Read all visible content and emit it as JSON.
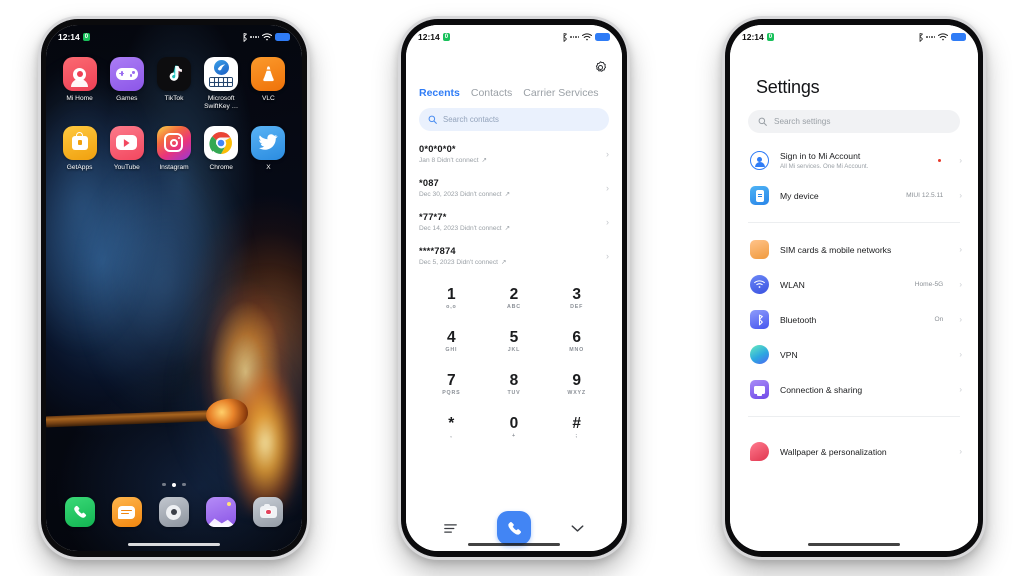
{
  "status_bar": {
    "time": "12:14",
    "battery_badge": "0",
    "icons": [
      "bluetooth-icon",
      "signal-dots-icon",
      "wifi-icon",
      "battery-icon"
    ],
    "battery_color": "#2f7cf6"
  },
  "home_screen": {
    "wallpaper_description": "burning matchstick",
    "apps": [
      {
        "label": "Mi Home",
        "icon": "mi-home-icon",
        "color": "#f2545c"
      },
      {
        "label": "Games",
        "icon": "games-icon",
        "color": "#9b6ef0"
      },
      {
        "label": "TikTok",
        "icon": "tiktok-icon",
        "color": "#0d0d0f"
      },
      {
        "label": "Microsoft SwiftKey …",
        "icon": "swiftkey-icon",
        "color": "#ffffff"
      },
      {
        "label": "VLC",
        "icon": "vlc-icon",
        "color": "#f08013"
      },
      {
        "label": "GetApps",
        "icon": "getapps-icon",
        "color": "#f5b528"
      },
      {
        "label": "YouTube",
        "icon": "youtube-icon",
        "color": "#f7596e"
      },
      {
        "label": "Instagram",
        "icon": "instagram-icon",
        "color": "#e8508f"
      },
      {
        "label": "Chrome",
        "icon": "chrome-icon",
        "color": "#ffffff"
      },
      {
        "label": "X",
        "icon": "x-twitter-icon",
        "color": "#3fa0ef"
      }
    ],
    "page_dots": {
      "count": 3,
      "active_index": 1
    },
    "dock": [
      {
        "label": "Phone",
        "icon": "phone-icon",
        "color": "#22c35e"
      },
      {
        "label": "Messages",
        "icon": "messages-icon",
        "color": "#f5a623"
      },
      {
        "label": "Browser",
        "icon": "browser-icon",
        "color": "#9ea4ad"
      },
      {
        "label": "Gallery",
        "icon": "gallery-icon",
        "color": "#9b6ef0"
      },
      {
        "label": "Camera",
        "icon": "camera-icon",
        "color": "#a8aeb6"
      }
    ]
  },
  "dialer_screen": {
    "settings_icon": "gear-icon",
    "tabs": [
      {
        "label": "Recents",
        "active": true
      },
      {
        "label": "Contacts",
        "active": false
      },
      {
        "label": "Carrier Services",
        "active": false
      }
    ],
    "search": {
      "placeholder": "Search contacts",
      "icon": "search-icon"
    },
    "calls": [
      {
        "number": "0*0*0*0*",
        "detail": "Jan 8 Didn't connect"
      },
      {
        "number": "*087",
        "detail": "Dec 30, 2023 Didn't connect"
      },
      {
        "number": "*77*7*",
        "detail": "Dec 14, 2023 Didn't connect"
      },
      {
        "number": "****7874",
        "detail": "Dec 5, 2023 Didn't connect"
      }
    ],
    "dialpad": [
      {
        "digit": "1",
        "letters": "o,o"
      },
      {
        "digit": "2",
        "letters": "ABC"
      },
      {
        "digit": "3",
        "letters": "DEF"
      },
      {
        "digit": "4",
        "letters": "GHI"
      },
      {
        "digit": "5",
        "letters": "JKL"
      },
      {
        "digit": "6",
        "letters": "MNO"
      },
      {
        "digit": "7",
        "letters": "PQRS"
      },
      {
        "digit": "8",
        "letters": "TUV"
      },
      {
        "digit": "9",
        "letters": "WXYZ"
      },
      {
        "digit": "*",
        "letters": ","
      },
      {
        "digit": "0",
        "letters": "+"
      },
      {
        "digit": "#",
        "letters": ";"
      }
    ],
    "actions": {
      "menu_icon": "menu-icon",
      "call_icon": "call-icon",
      "collapse_icon": "chevron-down-icon",
      "call_button_color": "#4285f4"
    }
  },
  "settings_screen": {
    "title": "Settings",
    "search": {
      "placeholder": "Search settings",
      "icon": "search-icon"
    },
    "account": {
      "label": "Sign in to Mi Account",
      "sub": "All Mi services. One Mi Account.",
      "icon": "account-icon",
      "badge_color": "#e8392b"
    },
    "device": {
      "label": "My device",
      "value": "MIUI 12.5.11",
      "icon": "device-icon"
    },
    "items": [
      {
        "label": "SIM cards & mobile networks",
        "value": "",
        "icon": "sim-card-icon",
        "color": "#f5a04a"
      },
      {
        "label": "WLAN",
        "value": "Home-5G",
        "icon": "wlan-icon",
        "color": "#4a6df0"
      },
      {
        "label": "Bluetooth",
        "value": "On",
        "icon": "bluetooth-icon",
        "color": "#5b6ef5"
      },
      {
        "label": "VPN",
        "value": "",
        "icon": "vpn-icon",
        "color": "#2fb8d6"
      },
      {
        "label": "Connection & sharing",
        "value": "",
        "icon": "connection-icon",
        "color": "#7b5ef0"
      }
    ],
    "personalization": [
      {
        "label": "Wallpaper & personalization",
        "value": "",
        "icon": "wallpaper-icon",
        "color": "#ee4f66"
      }
    ]
  }
}
